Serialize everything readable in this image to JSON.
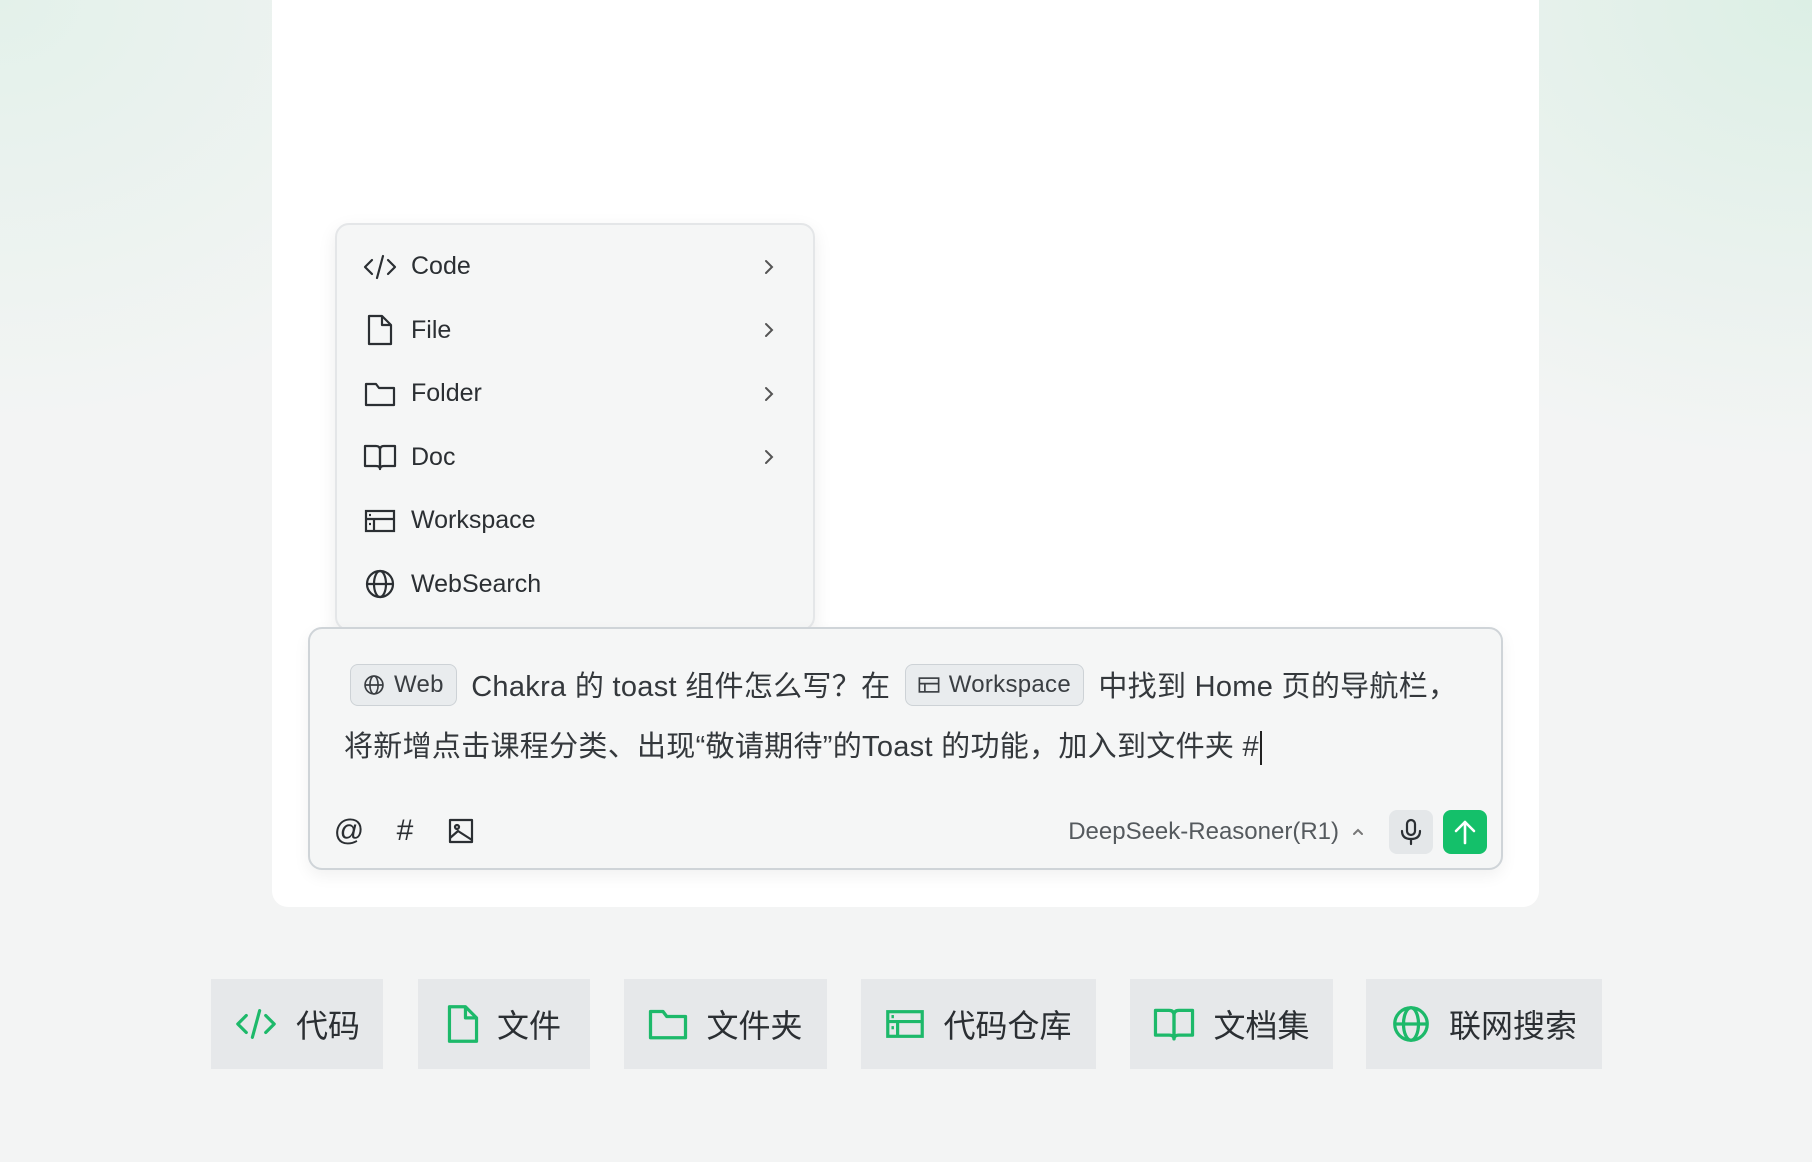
{
  "menu": {
    "items": [
      {
        "label": "Code",
        "icon": "code-icon",
        "has_submenu": true
      },
      {
        "label": "File",
        "icon": "file-icon",
        "has_submenu": true
      },
      {
        "label": "Folder",
        "icon": "folder-icon",
        "has_submenu": true
      },
      {
        "label": "Doc",
        "icon": "book-icon",
        "has_submenu": true
      },
      {
        "label": "Workspace",
        "icon": "workspace-icon",
        "has_submenu": false
      },
      {
        "label": "WebSearch",
        "icon": "globe-icon",
        "has_submenu": false
      }
    ]
  },
  "composer": {
    "chip_web": "Web",
    "text_1": "Chakra 的 toast 组件怎么写？在",
    "chip_workspace": "Workspace",
    "text_2": "中找到 Home 页的导航栏，将新增点击课程分类、出现“敬请期待”的Toast 的功能，加入到文件夹 #",
    "toolbar": {
      "mention": "@",
      "tag": "#"
    },
    "model": "DeepSeek-Reasoner(R1)"
  },
  "features": [
    {
      "label": "代码",
      "icon": "code-icon"
    },
    {
      "label": "文件",
      "icon": "file-icon"
    },
    {
      "label": "文件夹",
      "icon": "folder-icon"
    },
    {
      "label": "代码仓库",
      "icon": "workspace-icon"
    },
    {
      "label": "文档集",
      "icon": "book-icon"
    },
    {
      "label": "联网搜索",
      "icon": "globe-icon"
    }
  ],
  "colors": {
    "accent": "#14c06a",
    "icon_green": "#1db96a"
  }
}
